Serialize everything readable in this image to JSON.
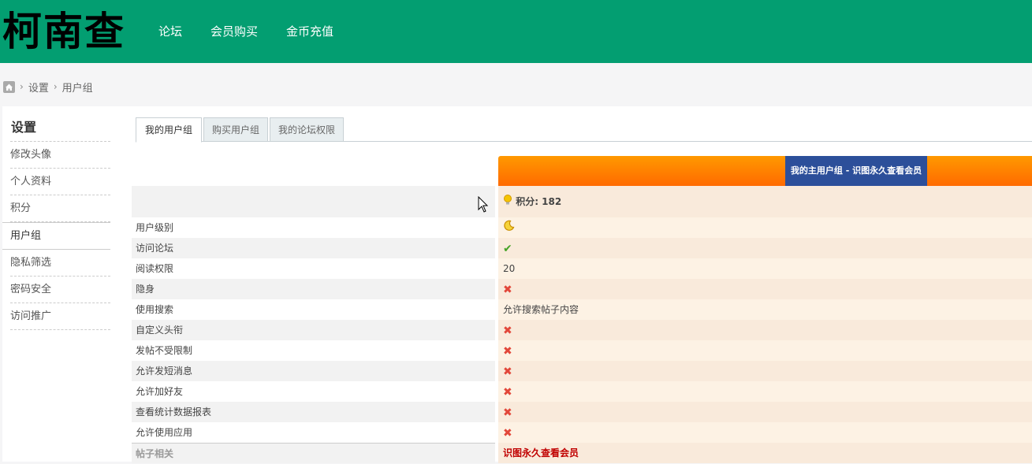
{
  "header": {
    "logo": "柯南查",
    "nav": [
      "论坛",
      "会员购买",
      "金币充值"
    ]
  },
  "breadcrumb": {
    "items": [
      "设置",
      "用户组"
    ]
  },
  "sidebar": {
    "title": "设置",
    "items": [
      "修改头像",
      "个人资料",
      "积分",
      "用户组",
      "隐私筛选",
      "密码安全",
      "访问推广"
    ],
    "active": "用户组"
  },
  "tabs": [
    "我的用户组",
    "购买用户组",
    "我的论坛权限"
  ],
  "table": {
    "header_title": "我的主用户组 - 识图永久查看会员",
    "points_label": "积分: 182",
    "rows": [
      {
        "label": "用户级别",
        "type": "icon",
        "icon": "moon-icon"
      },
      {
        "label": "访问论坛",
        "type": "check"
      },
      {
        "label": "阅读权限",
        "type": "text",
        "value": "20"
      },
      {
        "label": "隐身",
        "type": "cross"
      },
      {
        "label": "使用搜索",
        "type": "text",
        "value": "允许搜索帖子内容"
      },
      {
        "label": "自定义头衔",
        "type": "cross"
      },
      {
        "label": "发帖不受限制",
        "type": "cross"
      },
      {
        "label": "允许发短消息",
        "type": "cross"
      },
      {
        "label": "允许加好友",
        "type": "cross"
      },
      {
        "label": "查看统计数据报表",
        "type": "cross"
      },
      {
        "label": "允许使用应用",
        "type": "cross"
      }
    ],
    "section": {
      "label": "帖子相关",
      "value": "识图永久查看会员"
    }
  },
  "colors": {
    "header_bg": "#039e71",
    "accent_orange": "#ff7f00",
    "header_title_bg": "#2c4f9a",
    "cross": "#e2473a",
    "check": "#45a226"
  }
}
